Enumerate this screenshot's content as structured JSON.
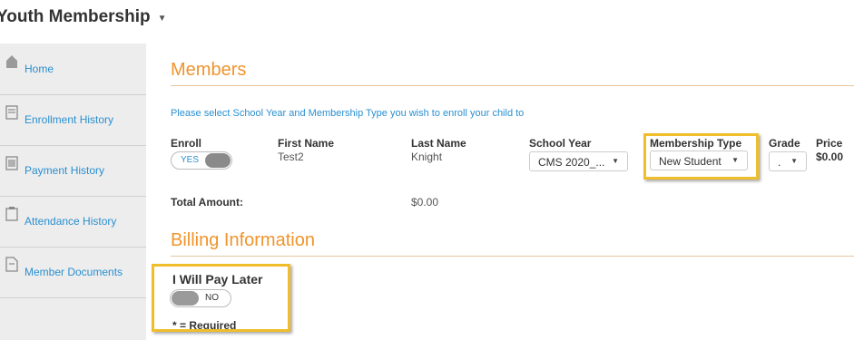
{
  "header": {
    "title": "Youth Membership",
    "caret_icon": "caret-down-icon"
  },
  "sidebar": {
    "items": [
      {
        "label": "Home",
        "icon": "home-icon"
      },
      {
        "label": "Enrollment History",
        "icon": "list-icon"
      },
      {
        "label": "Payment History",
        "icon": "payment-icon"
      },
      {
        "label": "Attendance History",
        "icon": "clipboard-icon"
      },
      {
        "label": "Member Documents",
        "icon": "document-icon"
      }
    ]
  },
  "members": {
    "title": "Members",
    "instruction": "Please select School Year and Membership Type you wish to enroll your child to",
    "columns": [
      "Enroll",
      "First Name",
      "Last Name",
      "School Year",
      "Membership Type",
      "Grade",
      "Price"
    ],
    "row": {
      "enroll_toggle": "YES",
      "first_name": "Test2",
      "last_name": "Knight",
      "school_year": "CMS 2020_...",
      "membership_type": "New Student",
      "grade": ".",
      "price": "$0.00"
    },
    "total_label": "Total Amount:",
    "total_value": "$0.00"
  },
  "billing": {
    "title": "Billing Information",
    "pay_later_label": "I Will Pay Later",
    "pay_later_toggle": "NO",
    "required_note": "* = Required"
  },
  "colors": {
    "accent": "#f0942c",
    "link": "#2a8fd0",
    "highlight": "#efbe2a"
  }
}
